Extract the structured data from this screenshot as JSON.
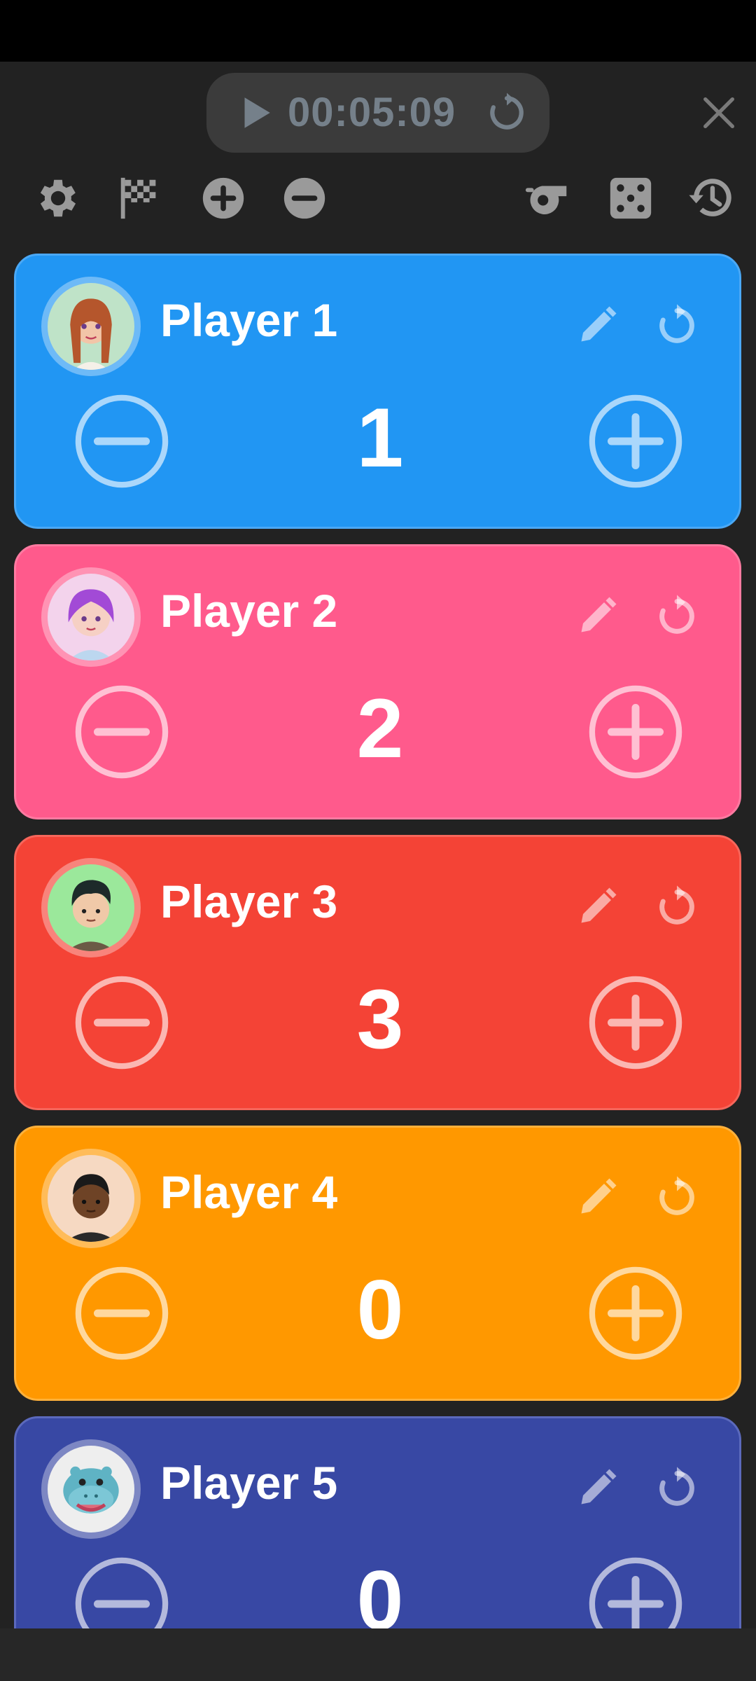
{
  "timer": {
    "time": "00:05:09",
    "play_icon": "play-icon",
    "reset_icon": "timer-reset-icon"
  },
  "close_icon": "close-icon",
  "toolbar": {
    "left": [
      "gear-icon",
      "checkered-flag-icon",
      "add-player-icon",
      "remove-player-icon"
    ],
    "right": [
      "whistle-icon",
      "dice-icon",
      "history-icon"
    ]
  },
  "players": [
    {
      "name": "Player 1",
      "score": "1",
      "color": "#2196F3",
      "border": "#4aa8f5",
      "avatar_bg": "#bfe3c8"
    },
    {
      "name": "Player 2",
      "score": "2",
      "color": "#FF5A8C",
      "border": "#ff7aa1",
      "avatar_bg": "#f3d3ec"
    },
    {
      "name": "Player 3",
      "score": "3",
      "color": "#F44336",
      "border": "#f6665b",
      "avatar_bg": "#9be89b"
    },
    {
      "name": "Player 4",
      "score": "0",
      "color": "#FF9800",
      "border": "#ffb13b",
      "avatar_bg": "#f6d9c2"
    },
    {
      "name": "Player 5",
      "score": "0",
      "color": "#3848A4",
      "border": "#5b69bc",
      "avatar_bg": "#eeeeee"
    }
  ]
}
